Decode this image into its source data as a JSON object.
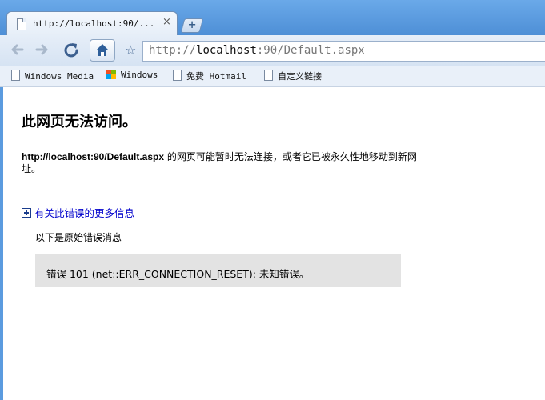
{
  "tab": {
    "title": "http://localhost:90/...",
    "close": "×"
  },
  "new_tab_label": "+",
  "omnibox": {
    "scheme": "http://",
    "host": "localhost",
    "rest": ":90/Default.aspx"
  },
  "bookmarks": [
    {
      "label": "Windows Media",
      "icon": "page-icon"
    },
    {
      "label": "Windows",
      "icon": "windows-logo-icon"
    },
    {
      "label": "免费 Hotmail",
      "icon": "page-icon"
    },
    {
      "label": "自定义链接",
      "icon": "page-icon"
    }
  ],
  "error_page": {
    "title": "此网页无法访问。",
    "url": "http://localhost:90/Default.aspx",
    "description": " 的网页可能暂时无法连接，或者它已被永久性地移动到新网址。",
    "more_info_link": "有关此错误的更多信息",
    "original_message_label": "以下是原始错误消息",
    "error_message": "错误 101 (net::ERR_CONNECTION_RESET): 未知错误。"
  },
  "colors": {
    "frame": "#5b9bdf",
    "link": "#0000cc",
    "error_box_bg": "#e3e3e3"
  }
}
